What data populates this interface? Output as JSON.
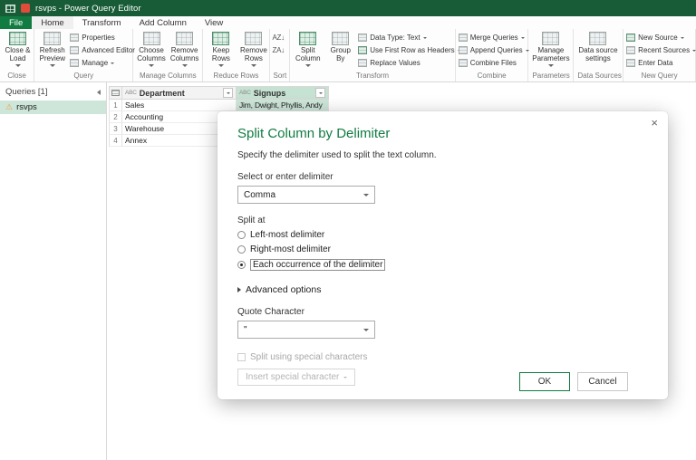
{
  "window": {
    "title": "rsvps - Power Query Editor"
  },
  "icons": {
    "close_x": "×",
    "warning": "⚠",
    "sort_az": "AZ↓",
    "sort_za": "ZA↓"
  },
  "tabs": {
    "file": "File",
    "home": "Home",
    "transform": "Transform",
    "add_column": "Add Column",
    "view": "View"
  },
  "ribbon": {
    "close": {
      "label": "Close",
      "close_load": "Close &\nLoad"
    },
    "query": {
      "label": "Query",
      "refresh": "Refresh\nPreview",
      "properties": "Properties",
      "advanced_editor": "Advanced Editor",
      "manage": "Manage"
    },
    "manage_columns": {
      "label": "Manage Columns",
      "choose": "Choose\nColumns",
      "remove": "Remove\nColumns"
    },
    "reduce_rows": {
      "label": "Reduce Rows",
      "keep": "Keep\nRows",
      "remove": "Remove\nRows"
    },
    "sort": {
      "label": "Sort"
    },
    "transform": {
      "label": "Transform",
      "split": "Split\nColumn",
      "group": "Group\nBy",
      "data_type": "Data Type: Text",
      "first_row": "Use First Row as Headers",
      "replace": "Replace Values"
    },
    "combine": {
      "label": "Combine",
      "merge": "Merge Queries",
      "append": "Append Queries",
      "files": "Combine Files"
    },
    "parameters": {
      "label": "Parameters",
      "manage": "Manage\nParameters"
    },
    "data_sources": {
      "label": "Data Sources",
      "settings": "Data source\nsettings"
    },
    "new_query": {
      "label": "New Query",
      "new_source": "New Source",
      "recent": "Recent Sources",
      "enter": "Enter Data"
    }
  },
  "queries_pane": {
    "header": "Queries [1]",
    "items": [
      {
        "name": "rsvps"
      }
    ]
  },
  "grid": {
    "type_icon": "ABC",
    "columns": [
      {
        "name": "Department"
      },
      {
        "name": "Signups"
      }
    ],
    "rows": [
      {
        "n": "1",
        "department": "Sales",
        "signups": "Jim, Dwight, Phyllis, Andy"
      },
      {
        "n": "2",
        "department": "Accounting",
        "signups": ""
      },
      {
        "n": "3",
        "department": "Warehouse",
        "signups": ""
      },
      {
        "n": "4",
        "department": "Annex",
        "signups": ""
      }
    ]
  },
  "dialog": {
    "title": "Split Column by Delimiter",
    "description": "Specify the delimiter used to split the text column.",
    "delimiter_label": "Select or enter delimiter",
    "delimiter_value": "Comma",
    "split_at_label": "Split at",
    "options": [
      {
        "label": "Left-most delimiter",
        "selected": false
      },
      {
        "label": "Right-most delimiter",
        "selected": false
      },
      {
        "label": "Each occurrence of the delimiter",
        "selected": true
      }
    ],
    "advanced_label": "Advanced options",
    "quote_label": "Quote Character",
    "quote_value": "\"",
    "special_checkbox_label": "Split using special characters",
    "special_button_label": "Insert special character",
    "ok": "OK",
    "cancel": "Cancel"
  },
  "colors": {
    "accent": "#107C41",
    "titlebar": "#185C37",
    "selection": "#CDE6D9"
  }
}
